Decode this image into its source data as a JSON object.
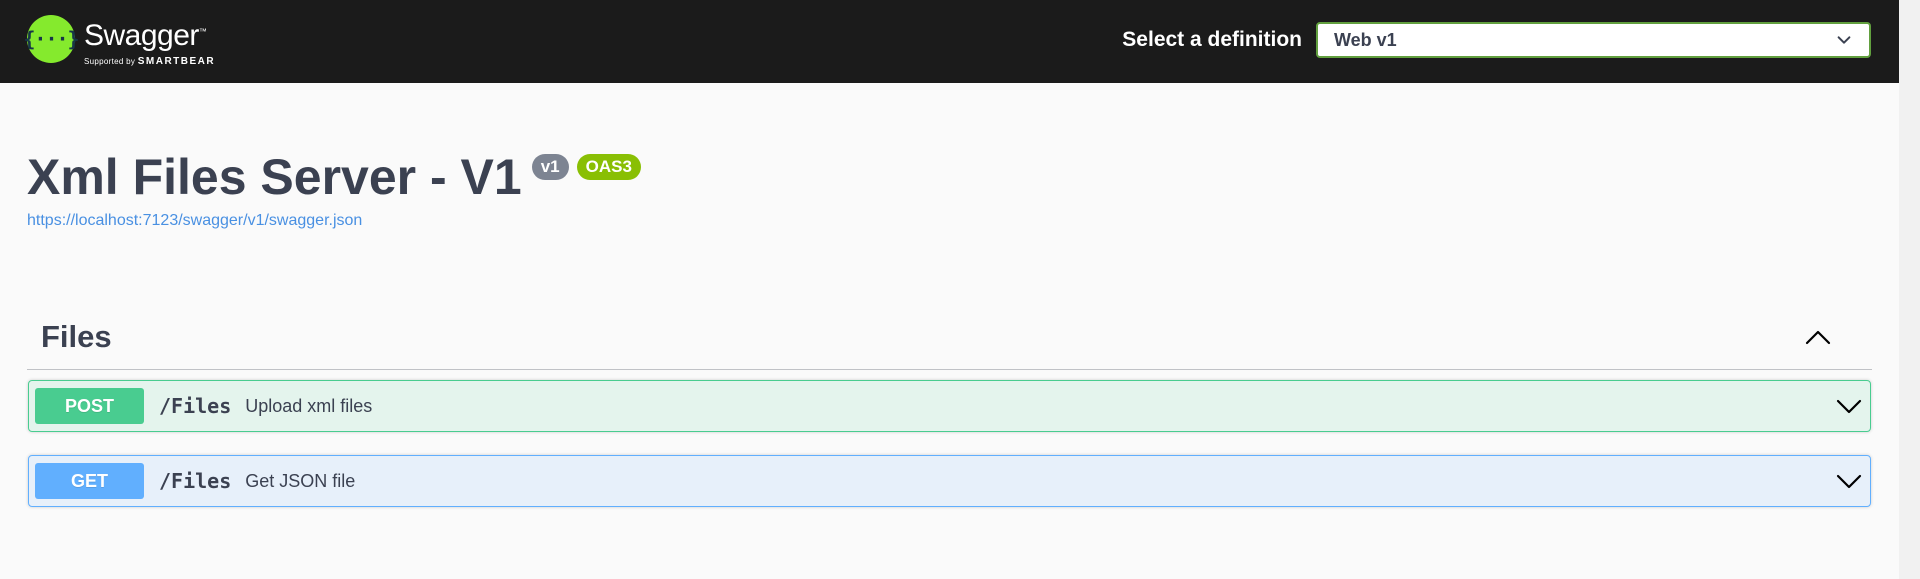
{
  "topbar": {
    "logo_name": "Swagger",
    "logo_tm": "™",
    "logo_supported": "Supported by",
    "logo_company": "SMARTBEAR",
    "logo_icon": "{···}",
    "definition_label": "Select a definition",
    "definition_value": "Web v1"
  },
  "info": {
    "title": "Xml Files Server - V1",
    "version_badge": "v1",
    "oas_badge": "OAS3",
    "spec_url": "https://localhost:7123/swagger/v1/swagger.json"
  },
  "tag": {
    "name": "Files"
  },
  "operations": [
    {
      "method": "POST",
      "path": "/Files",
      "summary": "Upload xml files"
    },
    {
      "method": "GET",
      "path": "/Files",
      "summary": "Get JSON file"
    }
  ],
  "colors": {
    "topbar_bg": "#1b1b1b",
    "logo_green": "#85ea2d",
    "post": "#49cc90",
    "get": "#61affe",
    "badge_version": "#7d8492",
    "badge_oas": "#89bf04",
    "link": "#4990e2"
  }
}
